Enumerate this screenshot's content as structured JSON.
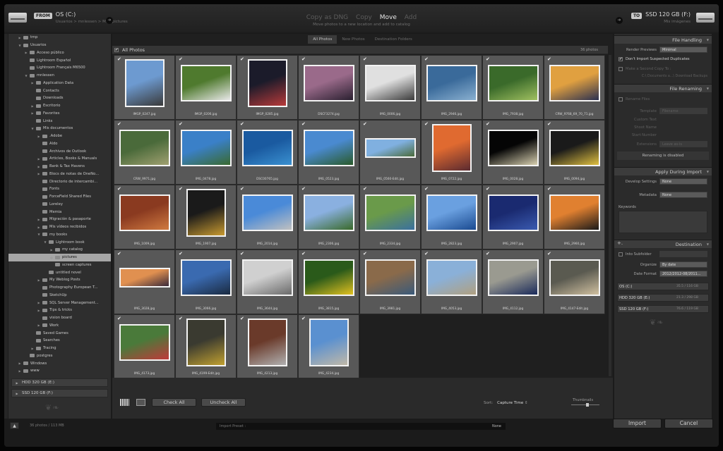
{
  "source": {
    "badge": "FROM",
    "name": "OS (C:)",
    "path": "Usuarios > mnlessen > M...\\ pictures"
  },
  "destination": {
    "badge": "TO",
    "name": "SSD 120 GB (F:)",
    "path": "Mis imágenes"
  },
  "modes": [
    "Copy as DNG",
    "Copy",
    "Move",
    "Add"
  ],
  "active_mode": "Move",
  "mode_description": "Move photos to a new location and add to catalog",
  "tabs": [
    "All Photos",
    "New Photos",
    "Destination Folders"
  ],
  "tree": [
    {
      "label": "tmp",
      "depth": 1,
      "exp": "▶"
    },
    {
      "label": "Usuarios",
      "depth": 1,
      "exp": "▼"
    },
    {
      "label": "Acceso público",
      "depth": 2,
      "exp": "▶"
    },
    {
      "label": "Lightroom Español",
      "depth": 2,
      "exp": ""
    },
    {
      "label": "Lightroom Français M6500",
      "depth": 2,
      "exp": ""
    },
    {
      "label": "mnlessen",
      "depth": 2,
      "exp": "▼"
    },
    {
      "label": "Application Data",
      "depth": 3,
      "exp": "▶"
    },
    {
      "label": "Contacts",
      "depth": 3,
      "exp": ""
    },
    {
      "label": "Downloads",
      "depth": 3,
      "exp": ""
    },
    {
      "label": "Escritorio",
      "depth": 3,
      "exp": "▶"
    },
    {
      "label": "Favorites",
      "depth": 3,
      "exp": "▶"
    },
    {
      "label": "Links",
      "depth": 3,
      "exp": ""
    },
    {
      "label": "Mis documentos",
      "depth": 3,
      "exp": "▼"
    },
    {
      "label": ".Adobe",
      "depth": 4,
      "exp": "▶"
    },
    {
      "label": "Aldo",
      "depth": 4,
      "exp": ""
    },
    {
      "label": "Archivos de Outlook",
      "depth": 4,
      "exp": ""
    },
    {
      "label": "Articles, Books & Manuals",
      "depth": 4,
      "exp": "▶"
    },
    {
      "label": "Bank & Tax Havens",
      "depth": 4,
      "exp": "▶"
    },
    {
      "label": "Blocs de notas de OneNo...",
      "depth": 4,
      "exp": "▶"
    },
    {
      "label": "Directorio de intercambi...",
      "depth": 4,
      "exp": ""
    },
    {
      "label": "Fonts",
      "depth": 4,
      "exp": ""
    },
    {
      "label": "ForceField Shared Files",
      "depth": 4,
      "exp": ""
    },
    {
      "label": "Loreley",
      "depth": 4,
      "exp": ""
    },
    {
      "label": "Memia",
      "depth": 4,
      "exp": ""
    },
    {
      "label": "Migración & pasaporte",
      "depth": 4,
      "exp": "▶"
    },
    {
      "label": "Mis vídeos recibidos",
      "depth": 4,
      "exp": "▶"
    },
    {
      "label": "my books",
      "depth": 4,
      "exp": "▼"
    },
    {
      "label": "Lightroom book",
      "depth": 5,
      "exp": "▼"
    },
    {
      "label": "my catalog",
      "depth": 6,
      "exp": "▶"
    },
    {
      "label": "pictures",
      "depth": 6,
      "exp": "◎",
      "selected": true
    },
    {
      "label": "screen captures",
      "depth": 6,
      "exp": ""
    },
    {
      "label": "untitled novel",
      "depth": 5,
      "exp": ""
    },
    {
      "label": "My Weblog Posts",
      "depth": 4,
      "exp": "▶"
    },
    {
      "label": "Photography European T...",
      "depth": 4,
      "exp": ""
    },
    {
      "label": "SketchUp",
      "depth": 4,
      "exp": ""
    },
    {
      "label": "SQL Server Management...",
      "depth": 4,
      "exp": "▶"
    },
    {
      "label": "Tips & tricks",
      "depth": 4,
      "exp": "▶"
    },
    {
      "label": "vision board",
      "depth": 4,
      "exp": ""
    },
    {
      "label": "Work",
      "depth": 4,
      "exp": "▶"
    },
    {
      "label": "Saved Games",
      "depth": 3,
      "exp": ""
    },
    {
      "label": "Searches",
      "depth": 3,
      "exp": ""
    },
    {
      "label": "Tracing",
      "depth": 3,
      "exp": "▶"
    },
    {
      "label": "postgres",
      "depth": 2,
      "exp": ""
    },
    {
      "label": "Windows",
      "depth": 1,
      "exp": "▶"
    },
    {
      "label": "www",
      "depth": 1,
      "exp": "▶"
    }
  ],
  "volumes": [
    "HDD 320 GB (E:)",
    "SSD 120 GB (F:)"
  ],
  "grid_header": {
    "title": "All Photos",
    "count": "36 photos"
  },
  "photos": [
    {
      "name": "IMGP_0247.jpg",
      "c1": "#6d9ad0",
      "c2": "#3a3a3a",
      "o": "p"
    },
    {
      "name": "IMGP_0206.jpg",
      "c1": "#4f7a2e",
      "c2": "#e8e8e8",
      "o": "l"
    },
    {
      "name": "IMGP_0285.jpg",
      "c1": "#1b1b2a",
      "c2": "#b83a3a",
      "o": "p"
    },
    {
      "name": "DSCF3274.jpg",
      "c1": "#9a6a8a",
      "c2": "#2a2030",
      "o": "l"
    },
    {
      "name": "IMG_0006.jpg",
      "c1": "#e0e0e0",
      "c2": "#3a3a3a",
      "o": "l"
    },
    {
      "name": "IMG_2946.jpg",
      "c1": "#3a6a9a",
      "c2": "#8ab0d0",
      "o": "l"
    },
    {
      "name": "IMG_7938.jpg",
      "c1": "#3a6a2a",
      "c2": "#a0c060",
      "o": "l"
    },
    {
      "name": "CRW_9768_69_70_71.jpg",
      "c1": "#e0a040",
      "c2": "#2a3050",
      "o": "l"
    },
    {
      "name": "CRW_9971.jpg",
      "c1": "#4a6a3a",
      "c2": "#a0a070",
      "o": "l"
    },
    {
      "name": "IMG_0478.jpg",
      "c1": "#3a80c8",
      "c2": "#3a6a30",
      "o": "l"
    },
    {
      "name": "DSC00765.jpg",
      "c1": "#1a5aa0",
      "c2": "#3a90d0",
      "o": "l"
    },
    {
      "name": "IMG_0523.jpg",
      "c1": "#4a8ad0",
      "c2": "#2a5a2a",
      "o": "l"
    },
    {
      "name": "IMG_0560-Edit.jpg",
      "c1": "#80b0e0",
      "c2": "#4a6a3a",
      "o": "w"
    },
    {
      "name": "IMG_0722.jpg",
      "c1": "#e06a30",
      "c2": "#5a2a30",
      "o": "p"
    },
    {
      "name": "IMG_0028.jpg",
      "c1": "#050505",
      "c2": "#d8d0b0",
      "o": "l"
    },
    {
      "name": "IMG_0094.jpg",
      "c1": "#1a1a1a",
      "c2": "#e0c040",
      "o": "l"
    },
    {
      "name": "IMG_1009.jpg",
      "c1": "#8a3a20",
      "c2": "#d07a40",
      "o": "l"
    },
    {
      "name": "IMG_1907.jpg",
      "c1": "#1a1a1a",
      "c2": "#c89a30",
      "o": "p"
    },
    {
      "name": "IMG_2014.jpg",
      "c1": "#4a8ad8",
      "c2": "#c0c0c0",
      "o": "l"
    },
    {
      "name": "IMG_2306.jpg",
      "c1": "#8ab0e0",
      "c2": "#3a6a2a",
      "o": "l"
    },
    {
      "name": "IMG_2334.jpg",
      "c1": "#6a9a4a",
      "c2": "#3a70a0",
      "o": "l"
    },
    {
      "name": "IMG_2823.jpg",
      "c1": "#6aa0e0",
      "c2": "#1a4a90",
      "o": "l"
    },
    {
      "name": "IMG_2907.jpg",
      "c1": "#1a2a70",
      "c2": "#3a5ab0",
      "o": "l"
    },
    {
      "name": "IMG_2960.jpg",
      "c1": "#e08030",
      "c2": "#1a1a1a",
      "o": "l"
    },
    {
      "name": "IMG_3028.jpg",
      "c1": "#e09050",
      "c2": "#3a2a3a",
      "o": "w"
    },
    {
      "name": "IMG_3066.jpg",
      "c1": "#3a6ab0",
      "c2": "#1a2a40",
      "o": "l"
    },
    {
      "name": "IMG_3644.jpg",
      "c1": "#d0d0d0",
      "c2": "#6a6a6a",
      "o": "l"
    },
    {
      "name": "IMG_3815.jpg",
      "c1": "#2a5a1a",
      "c2": "#e0c020",
      "o": "l"
    },
    {
      "name": "IMG_3981.jpg",
      "c1": "#8a6a4a",
      "c2": "#3a5a7a",
      "o": "l"
    },
    {
      "name": "IMG_4053.jpg",
      "c1": "#8ab0d8",
      "c2": "#b0a080",
      "o": "l"
    },
    {
      "name": "IMG_4112.jpg",
      "c1": "#9a9a90",
      "c2": "#1a2a5a",
      "o": "l"
    },
    {
      "name": "IMG_4147-Edit.jpg",
      "c1": "#5a5a50",
      "c2": "#d0c0a0",
      "o": "l"
    },
    {
      "name": "IMG_4173.jpg",
      "c1": "#4a7a3a",
      "c2": "#c03a3a",
      "o": "l"
    },
    {
      "name": "IMG_4199-Edit.jpg",
      "c1": "#3a3a30",
      "c2": "#c0a030",
      "o": "p"
    },
    {
      "name": "IMG_4213.jpg",
      "c1": "#6a3a2a",
      "c2": "#b0b0b0",
      "o": "p"
    },
    {
      "name": "IMG_4234.jpg",
      "c1": "#5a90d0",
      "c2": "#c0b8a8",
      "o": "p"
    }
  ],
  "bottombar": {
    "check_all": "Check All",
    "uncheck_all": "Uncheck All",
    "sort_label": "Sort:",
    "sort_value": "Capture Time",
    "thumbnails_label": "Thumbnails"
  },
  "file_handling": {
    "title": "File Handling",
    "render_previews_label": "Render Previews",
    "render_previews_value": "Minimal",
    "no_duplicates": "Don't Import Suspected Duplicates",
    "second_copy": "Make a Second Copy To :",
    "second_copy_path": "C:\\ Documents a...\\ Download Backups"
  },
  "file_renaming": {
    "title": "File Renaming",
    "rename_files": "Rename Files",
    "template_label": "Template",
    "template_value": "Filename",
    "custom_text": "Custom Text",
    "shoot_name": "Shoot Name",
    "start_number": "Start Number",
    "extensions_label": "Extensions",
    "extensions_value": "Leave as-is",
    "disabled": "Renaming is disabled"
  },
  "apply_import": {
    "title": "Apply During Import",
    "develop_label": "Develop Settings",
    "develop_value": "None",
    "metadata_label": "Metadata",
    "metadata_value": "None",
    "keywords_label": "Keywords"
  },
  "destination_panel": {
    "title": "Destination",
    "into_subfolder": "Into Subfolder",
    "organize_label": "Organize",
    "organize_value": "By date",
    "date_format_label": "Date Format",
    "date_format_value": "2012/2012-08/2011...",
    "drives": [
      {
        "name": "OS (C:)",
        "size": "35.5 / 116 GB"
      },
      {
        "name": "HDD 320 GB (E:)",
        "size": "21.3 / 298 GB"
      },
      {
        "name": "SSD 120 GB (F:)",
        "size": "76.6 / 119 GB"
      }
    ]
  },
  "footer": {
    "summary": "36 photos / 113 MB",
    "import_preset": "Import Preset :",
    "preset_value": "None",
    "import": "Import",
    "cancel": "Cancel"
  }
}
